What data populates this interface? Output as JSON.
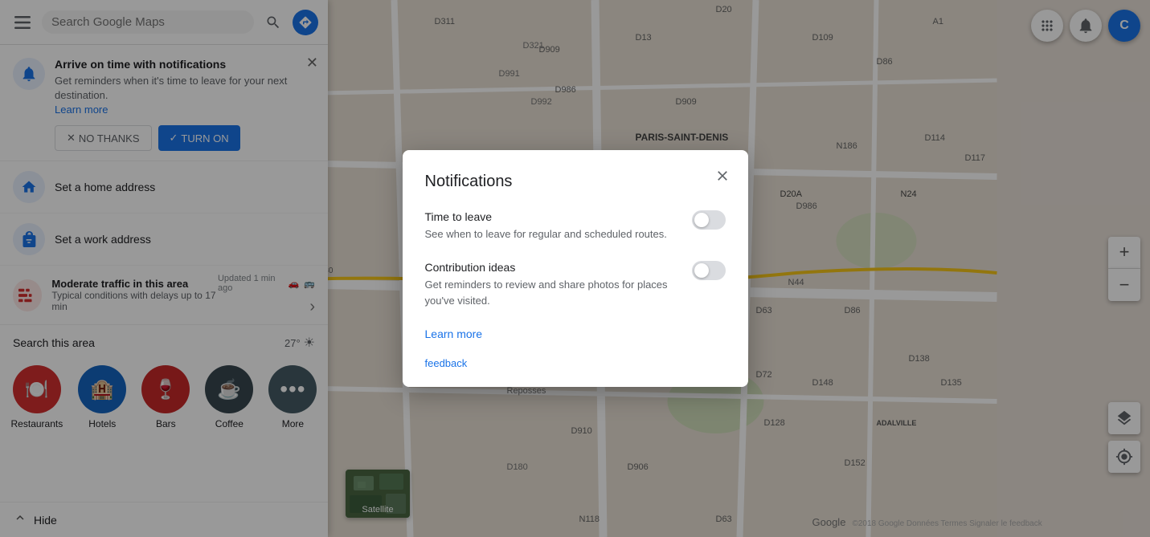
{
  "app": {
    "title": "Google Maps"
  },
  "search": {
    "placeholder": "Search Google Maps",
    "value": ""
  },
  "notification_banner": {
    "title": "Arrive on time with notifications",
    "description": "Get reminders when it's time to leave for your next destination.",
    "learn_more": "Learn more",
    "no_thanks": "NO THANKS",
    "turn_on": "TURN ON"
  },
  "addresses": [
    {
      "label": "Set a home address",
      "type": "home"
    },
    {
      "label": "Set a work address",
      "type": "work"
    }
  ],
  "traffic": {
    "updated_label": "Updated 1 min ago",
    "title": "Moderate traffic in this area",
    "subtitle": "Typical conditions with delays up to 17 min"
  },
  "search_area": {
    "label": "Search this area",
    "temperature": "27°"
  },
  "categories": [
    {
      "id": "restaurants",
      "label": "Restaurants",
      "icon": "🍽️"
    },
    {
      "id": "hotels",
      "label": "Hotels",
      "icon": "🏨"
    },
    {
      "id": "bars",
      "label": "Bars",
      "icon": "🍷"
    },
    {
      "id": "coffee",
      "label": "Coffee",
      "icon": "☕"
    },
    {
      "id": "more",
      "label": "More",
      "icon": "···"
    }
  ],
  "hide_panel": {
    "label": "Hide"
  },
  "modal": {
    "title": "Notifications",
    "time_to_leave": {
      "title": "Time to leave",
      "description": "See when to leave for regular and scheduled routes."
    },
    "contribution_ideas": {
      "title": "Contribution ideas",
      "description": "Get reminders to review and share photos for places you've visited."
    },
    "learn_more": "Learn more",
    "feedback": "feedback"
  },
  "satellite": {
    "label": "Satellite"
  },
  "icons": {
    "menu": "☰",
    "search": "🔍",
    "directions": "➤",
    "close": "✕",
    "bell": "🔔",
    "home": "🏠",
    "work": "💼",
    "car": "🚗",
    "transit": "🚌",
    "chevron_right": "›",
    "chevron_up": "∧",
    "sun": "☀",
    "apps_grid": "⋮⋮",
    "zoom_plus": "+",
    "zoom_minus": "−",
    "locate": "◎",
    "layers": "⊞"
  }
}
